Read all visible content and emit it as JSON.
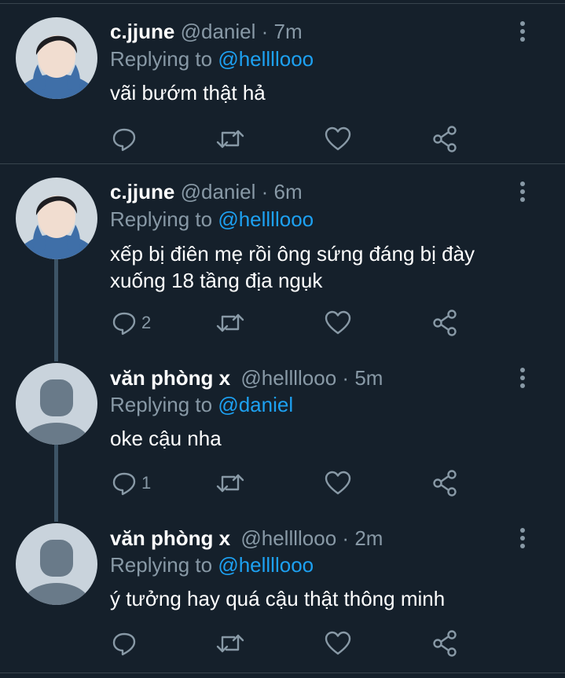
{
  "tweets": [
    {
      "name": "c.jjune",
      "handle": "@daniel",
      "dot": "·",
      "time": "7m",
      "replying_prefix": "Replying to",
      "replying_to": "@hellllooo",
      "text": "vãi bướm thật hả",
      "reply_count": "",
      "avatar_icon": "photo-avatar-icon"
    },
    {
      "name": "c.jjune",
      "handle": "@daniel",
      "dot": "·",
      "time": "6m",
      "replying_prefix": "Replying to",
      "replying_to": "@hellllooo",
      "text": "xếp bị điên mẹ rồi ông sứng đáng bị đày xuống 18 tầng địa ngụk",
      "reply_count": "2",
      "avatar_icon": "photo-avatar-icon"
    },
    {
      "name": "văn phòng x",
      "handle": "@hellllooo",
      "dot": "·",
      "time": "5m",
      "replying_prefix": "Replying to",
      "replying_to": "@daniel",
      "text": "oke cậu nha",
      "reply_count": "1",
      "avatar_icon": "default-avatar-icon"
    },
    {
      "name": "văn phòng x",
      "handle": "@hellllooo",
      "dot": "·",
      "time": "2m",
      "replying_prefix": "Replying to",
      "replying_to": "@hellllooo",
      "text": "ý tưởng hay quá cậu thật thông minh",
      "reply_count": "",
      "avatar_icon": "default-avatar-icon"
    }
  ],
  "colors": {
    "background": "#15202b",
    "secondary_text": "#8899a6",
    "link": "#1da1f2",
    "divider": "#38444d",
    "thread_line": "#3d5466"
  }
}
